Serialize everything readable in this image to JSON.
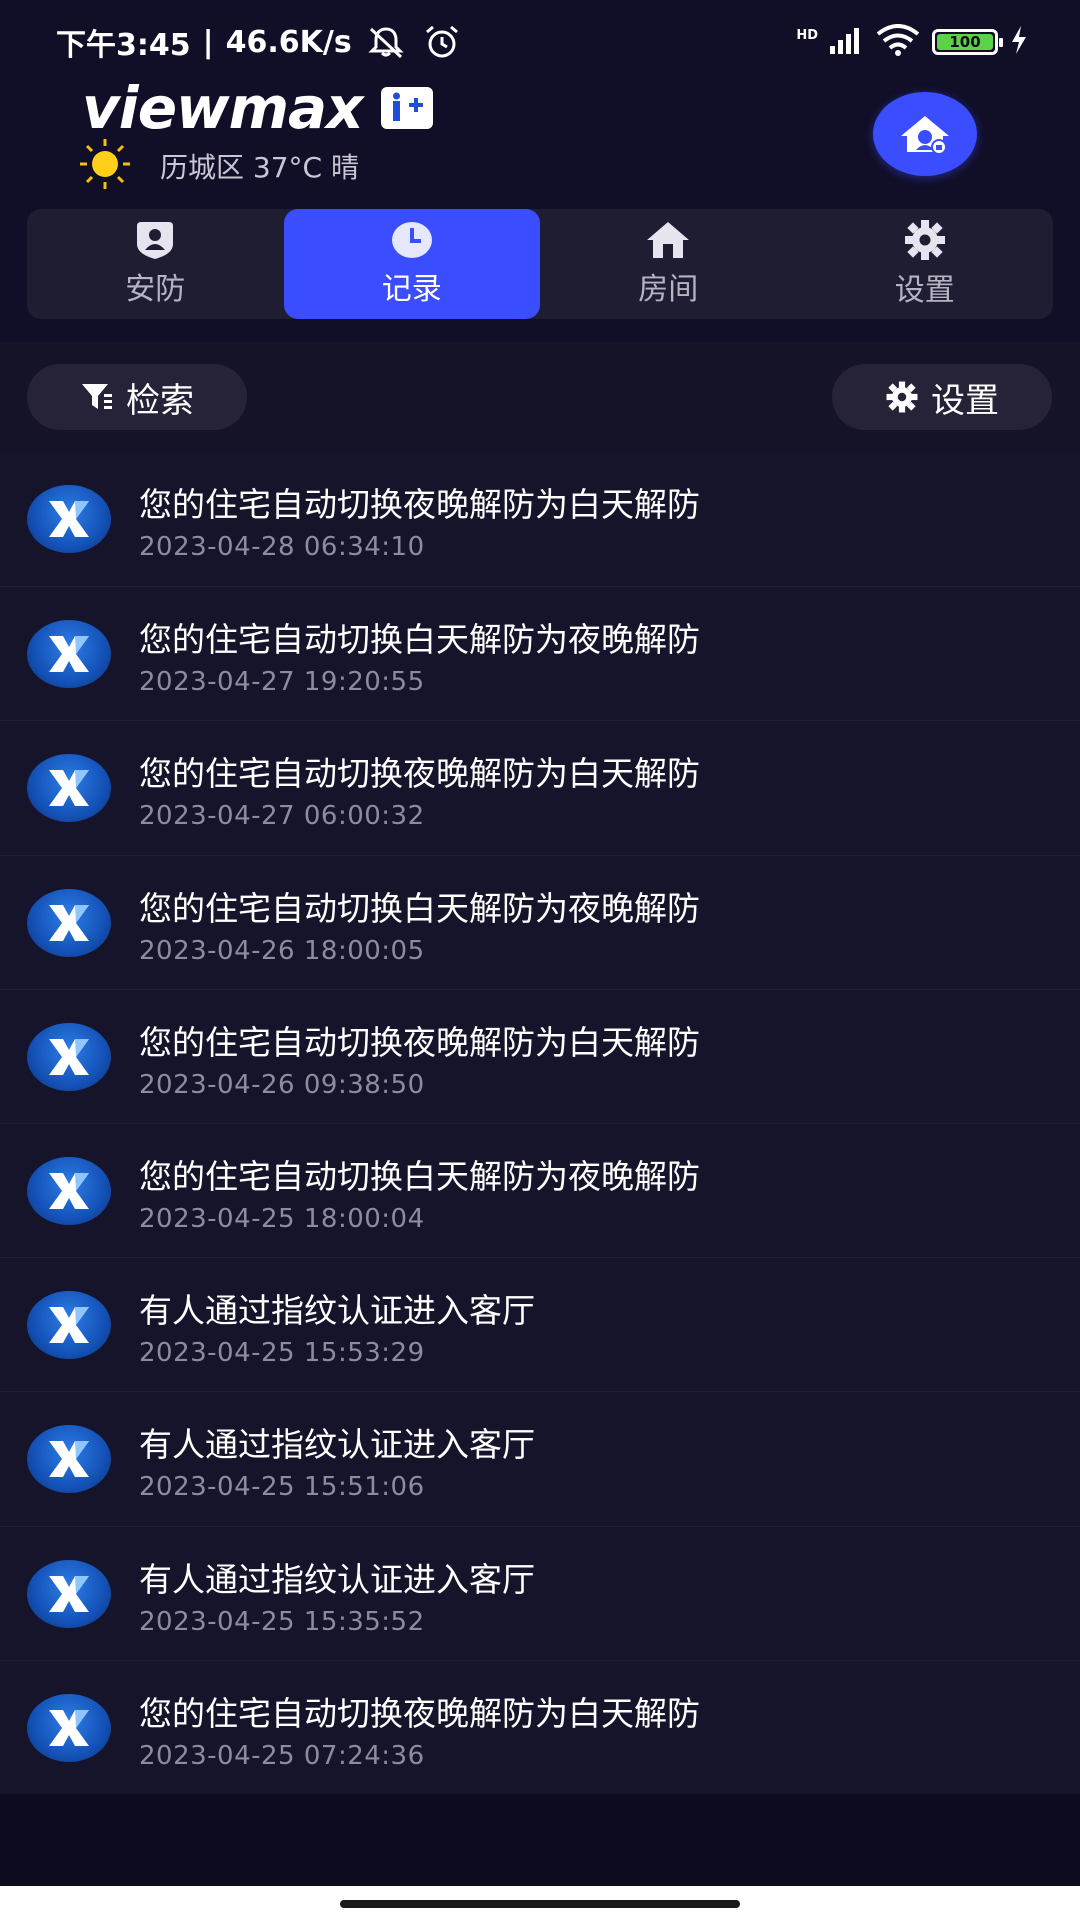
{
  "status_bar": {
    "time": "下午3:45",
    "network_speed": "46.6K/s",
    "battery": "100",
    "icons": [
      "mute-icon",
      "alarm-icon",
      "hd-icon",
      "signal-icon",
      "wifi-icon",
      "battery-icon",
      "charging-icon"
    ]
  },
  "header": {
    "brand": "viewmax",
    "weather_icon": "sun-icon",
    "weather_text": "历城区 37°C 晴",
    "home_button_icon": "home-lock-icon"
  },
  "tabs": [
    {
      "label": "安防",
      "icon": "shield-user-icon",
      "active": false
    },
    {
      "label": "记录",
      "icon": "clock-icon",
      "active": true
    },
    {
      "label": "房间",
      "icon": "house-icon",
      "active": false
    },
    {
      "label": "设置",
      "icon": "gear-icon",
      "active": false
    }
  ],
  "toolbar": {
    "search_label": "检索",
    "search_icon": "filter-icon",
    "settings_label": "设置",
    "settings_icon": "gear-icon"
  },
  "records": [
    {
      "title": "您的住宅自动切换夜晚解防为白天解防",
      "time": "2023-04-28 06:34:10"
    },
    {
      "title": "您的住宅自动切换白天解防为夜晚解防",
      "time": "2023-04-27 19:20:55"
    },
    {
      "title": "您的住宅自动切换夜晚解防为白天解防",
      "time": "2023-04-27 06:00:32"
    },
    {
      "title": "您的住宅自动切换白天解防为夜晚解防",
      "time": "2023-04-26 18:00:05"
    },
    {
      "title": "您的住宅自动切换夜晚解防为白天解防",
      "time": "2023-04-26 09:38:50"
    },
    {
      "title": "您的住宅自动切换白天解防为夜晚解防",
      "time": "2023-04-25 18:00:04"
    },
    {
      "title": "有人通过指纹认证进入客厅",
      "time": "2023-04-25 15:53:29"
    },
    {
      "title": "有人通过指纹认证进入客厅",
      "time": "2023-04-25 15:51:06"
    },
    {
      "title": "有人通过指纹认证进入客厅",
      "time": "2023-04-25 15:35:52"
    },
    {
      "title": "您的住宅自动切换夜晚解防为白天解防",
      "time": "2023-04-25 07:24:36"
    }
  ],
  "colors": {
    "background": "#0d0b1e",
    "accent": "#3a4dff",
    "list_background": "#16142a",
    "secondary_text": "#8e8b9e"
  }
}
